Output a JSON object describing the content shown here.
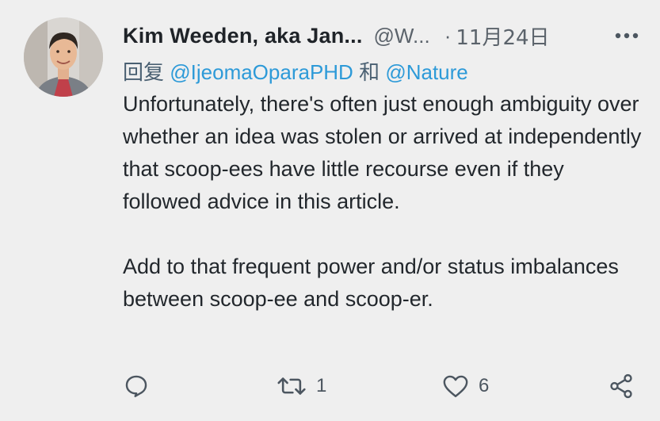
{
  "tweet": {
    "display_name": "Kim Weeden, aka Jan...",
    "handle": "@W...",
    "dot": "·",
    "date": "11月24日",
    "more_icon": "more-horizontal-icon",
    "reply": {
      "prefix": "回复",
      "mention1": "@IjeomaOparaPHD",
      "conjunction": "和",
      "mention2": "@Nature"
    },
    "paragraphs": [
      "Unfortunately, there's often just enough ambiguity over whether an idea was stolen or arrived at independently that scoop-ees have little recourse even if they followed advice in this article.",
      "Add to that frequent power and/or status imbalances between scoop-ee and scoop-er."
    ],
    "actions": {
      "reply": {
        "icon": "reply-icon",
        "count": ""
      },
      "retweet": {
        "icon": "retweet-icon",
        "count": "1"
      },
      "like": {
        "icon": "heart-icon",
        "count": "6"
      },
      "share": {
        "icon": "share-icon"
      }
    }
  }
}
